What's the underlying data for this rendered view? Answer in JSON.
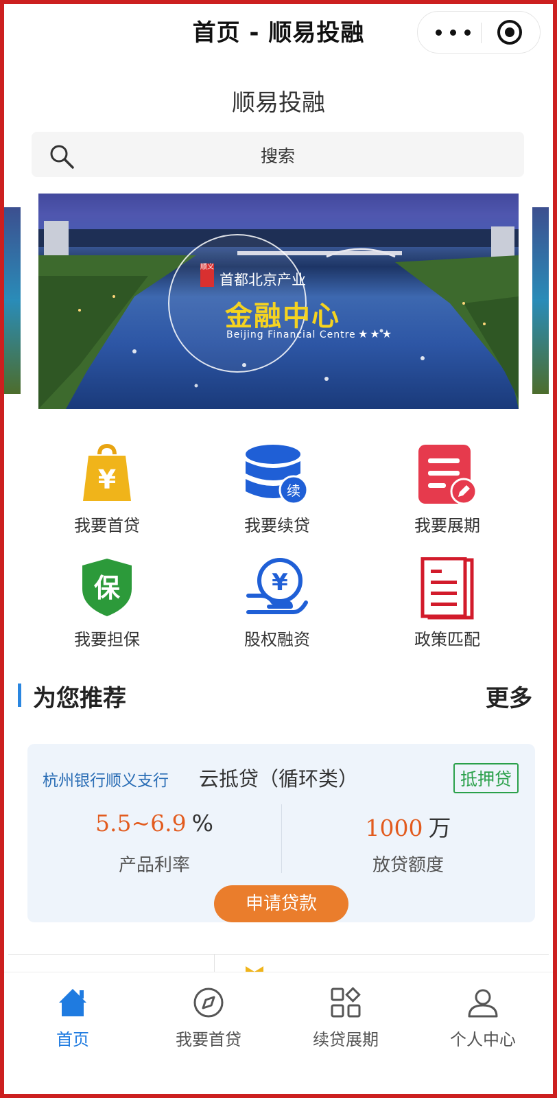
{
  "topbar": {
    "title": "首页 - 顺易投融"
  },
  "app": {
    "name": "顺易投融"
  },
  "search": {
    "placeholder": "搜索"
  },
  "banner": {
    "badge": "顺义",
    "line1": "首都北京产业",
    "line2": "金融中心",
    "line3": "Beijing Financial Centre",
    "stars": "★★★"
  },
  "menu": [
    {
      "label": "我要首贷",
      "icon": "shopping-bag-yen-icon"
    },
    {
      "label": "我要续贷",
      "icon": "database-continue-icon",
      "icon_text": "续"
    },
    {
      "label": "我要展期",
      "icon": "document-edit-icon"
    },
    {
      "label": "我要担保",
      "icon": "guarantee-shield-icon",
      "icon_text": "保"
    },
    {
      "label": "股权融资",
      "icon": "hand-yen-coin-icon"
    },
    {
      "label": "政策匹配",
      "icon": "policy-document-icon"
    }
  ],
  "section": {
    "title": "为您推荐",
    "more": "更多"
  },
  "card": {
    "bank": "杭州银行顺义支行",
    "product": "云抵贷（循环类）",
    "tag": "抵押贷",
    "rate_value": "5.5~6.9",
    "rate_unit": "%",
    "rate_label": "产品利率",
    "amount_value": "1000",
    "amount_unit": "万",
    "amount_label": "放贷额度",
    "apply": "申请贷款"
  },
  "tabs": [
    {
      "label": "首页",
      "icon": "home-icon",
      "active": true
    },
    {
      "label": "我要首贷",
      "icon": "compass-icon",
      "active": false
    },
    {
      "label": "续贷展期",
      "icon": "apps-grid-icon",
      "active": false
    },
    {
      "label": "个人中心",
      "icon": "user-icon",
      "active": false
    }
  ],
  "colors": {
    "accent": "#1f7be0",
    "apply_button": "#ea7d2c",
    "rate_number": "#e25b1e",
    "tag_green": "#2aa04a",
    "frame_red": "#cc1f1f"
  }
}
